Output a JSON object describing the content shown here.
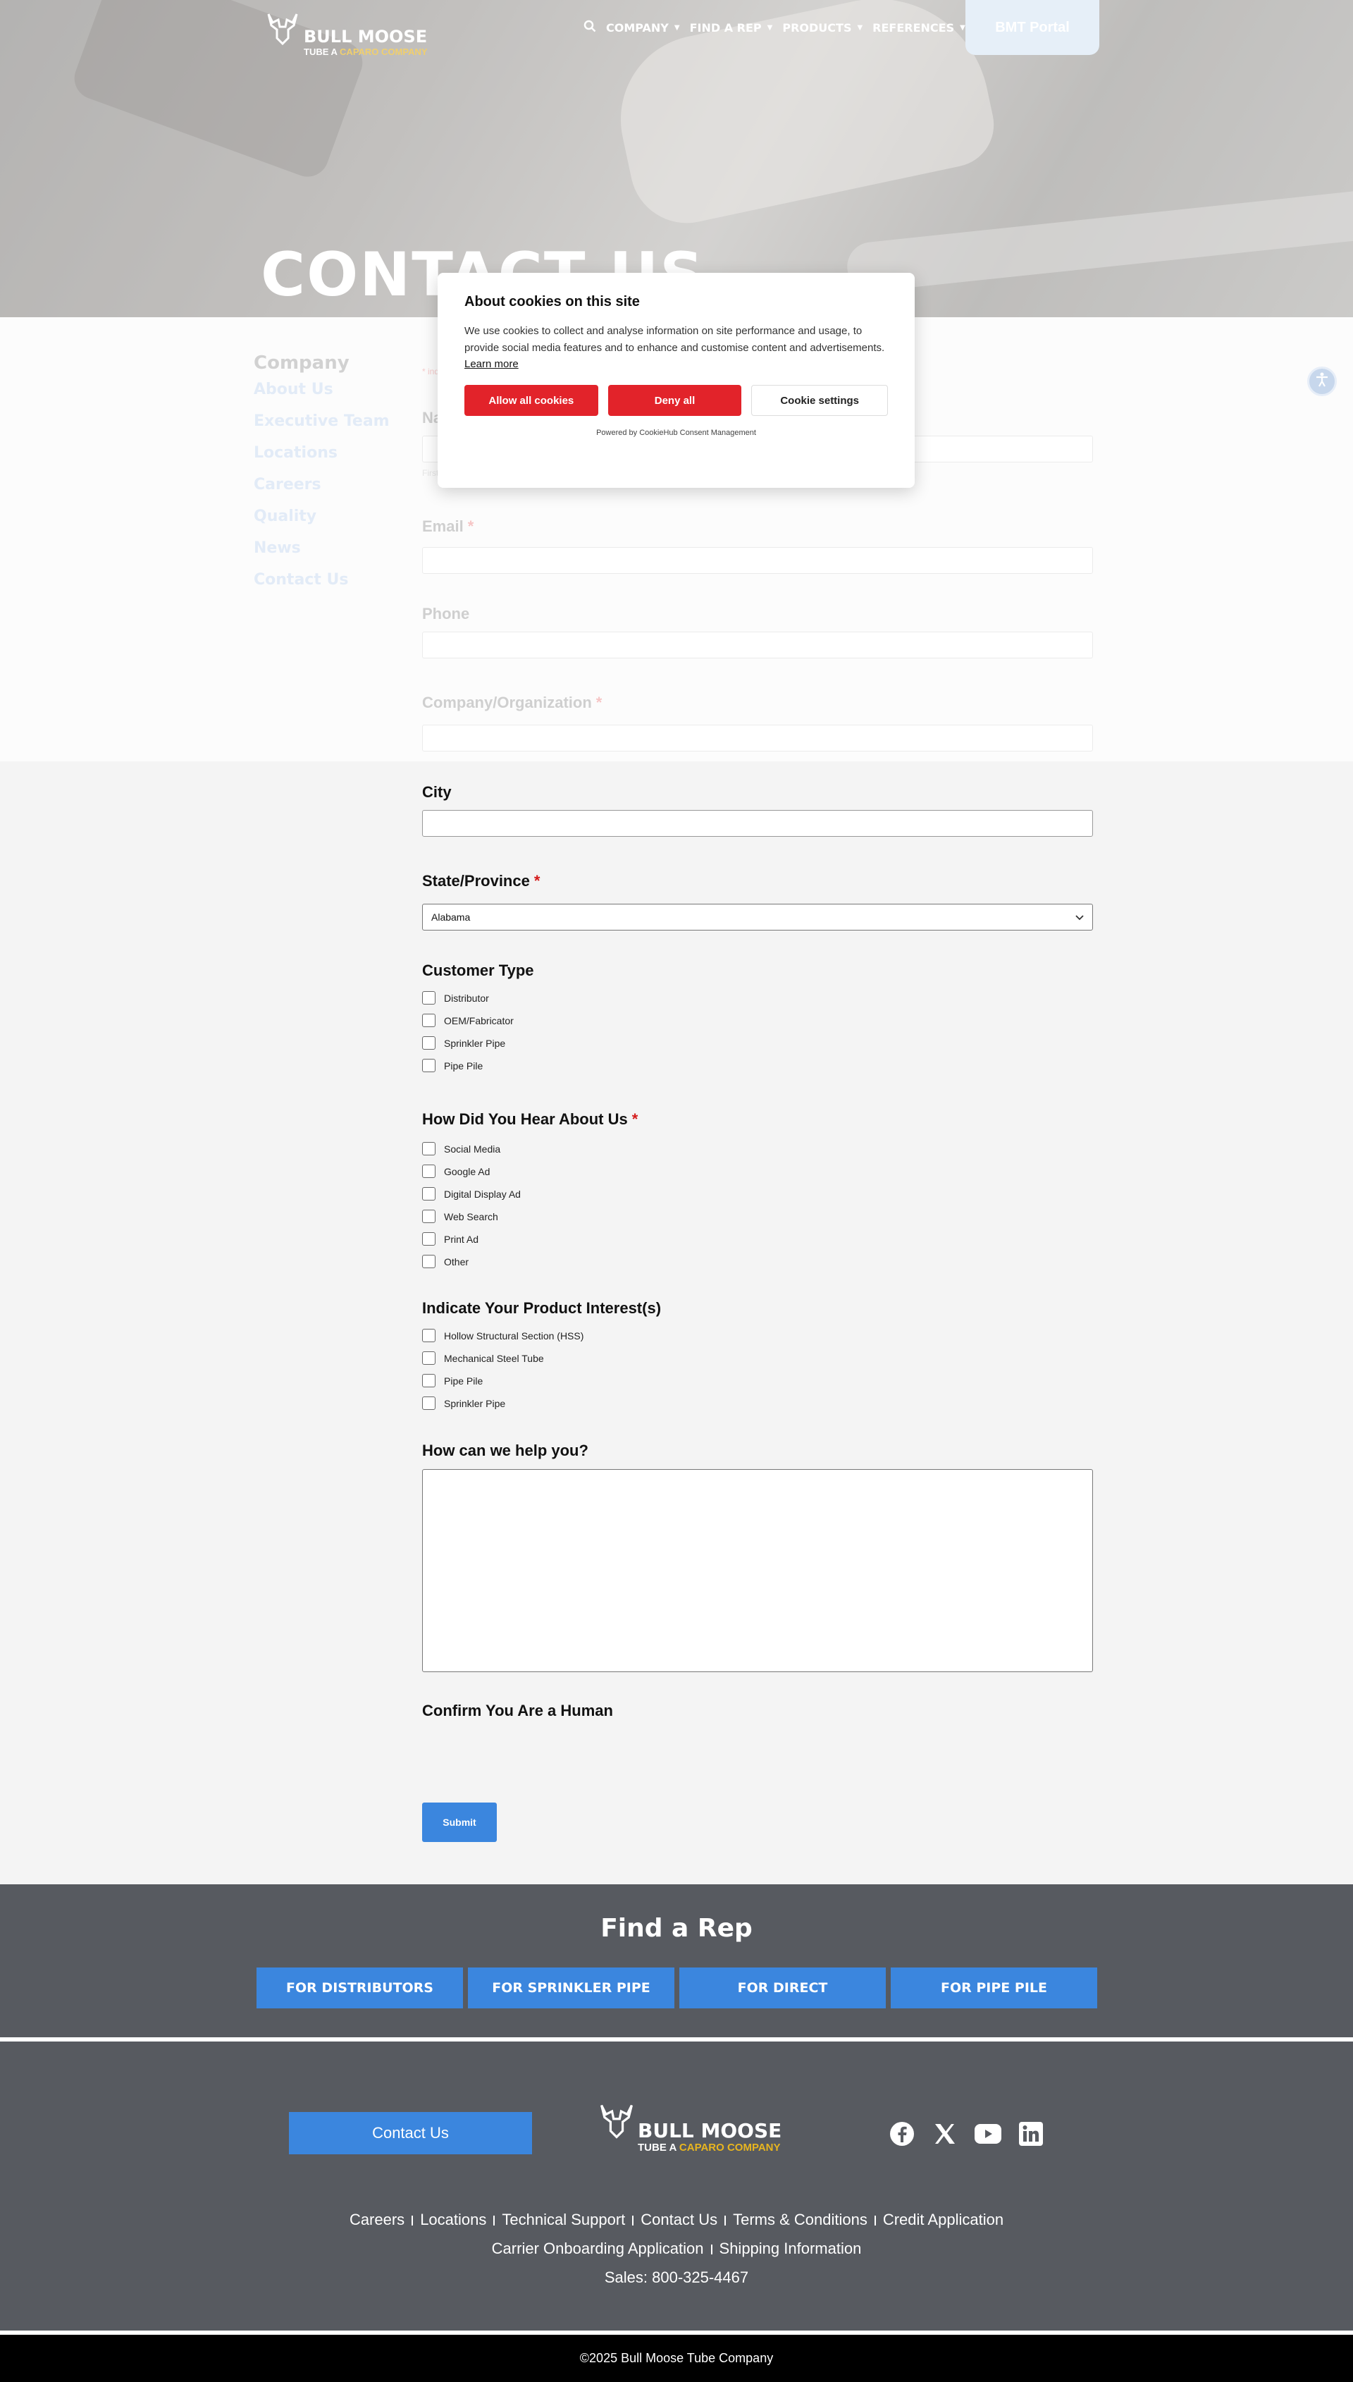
{
  "header": {
    "logo_brand": "BULL MOOSE",
    "logo_sub": "TUBE",
    "logo_sub_mid": " A ",
    "logo_sub_gold": "CAPARO COMPANY",
    "nav": [
      {
        "label": "COMPANY"
      },
      {
        "label": "FIND A REP"
      },
      {
        "label": "PRODUCTS"
      },
      {
        "label": "REFERENCES"
      }
    ],
    "portal_label": "BMT Portal"
  },
  "hero": {
    "title": "CONTACT US"
  },
  "sidebar": {
    "title": "Company",
    "links": [
      "About Us",
      "Executive Team",
      "Locations",
      "Careers",
      "Quality",
      "News",
      "Contact Us"
    ]
  },
  "form": {
    "required_note": "* indicates required fields",
    "name_label": "Name",
    "name_sub": "First",
    "email_label": "Email",
    "phone_label": "Phone",
    "company_label": "Company/Organization",
    "city_label": "City",
    "state_label": "State/Province",
    "state_value": "Alabama",
    "customer_type": {
      "label": "Customer Type",
      "options": [
        "Distributor",
        "OEM/Fabricator",
        "Sprinkler Pipe",
        "Pipe Pile"
      ]
    },
    "hear_about": {
      "label": "How Did You Hear About Us",
      "options": [
        "Social Media",
        "Google Ad",
        "Digital Display Ad",
        "Web Search",
        "Print Ad",
        "Other"
      ]
    },
    "product_interest": {
      "label": "Indicate Your Product Interest(s)",
      "options": [
        "Hollow Structural Section (HSS)",
        "Mechanical Steel Tube",
        "Pipe Pile",
        "Sprinkler Pipe"
      ]
    },
    "help_label": "How can we help you?",
    "human_label": "Confirm You Are a Human",
    "submit_label": "Submit"
  },
  "cookie": {
    "title": "About cookies on this site",
    "body": "We use cookies to collect and analyse information on site performance and usage, to provide social media features and to enhance and customise content and advertisements.",
    "learn_more": "Learn more",
    "allow_all": "Allow all cookies",
    "deny_all": "Deny all",
    "settings": "Cookie settings",
    "powered": "Powered by CookieHub Consent Management"
  },
  "find_rep": {
    "title": "Find a Rep",
    "buttons": [
      "FOR DISTRIBUTORS",
      "FOR SPRINKLER PIPE",
      "FOR DIRECT",
      "FOR PIPE PILE"
    ]
  },
  "footer": {
    "contact_button": "Contact Us",
    "logo_brand": "BULL MOOSE",
    "logo_sub": "TUBE",
    "logo_sub_mid": " A ",
    "logo_sub_gold": "CAPARO COMPANY",
    "links_row1": [
      "Careers",
      "Locations",
      "Technical Support",
      "Contact Us",
      "Terms & Conditions",
      "Credit Application"
    ],
    "links_row2": [
      "Carrier Onboarding Application",
      "Shipping Information"
    ],
    "sales": "Sales: 800-325-4467",
    "copyright": "©2025 Bull Moose Tube Company"
  }
}
